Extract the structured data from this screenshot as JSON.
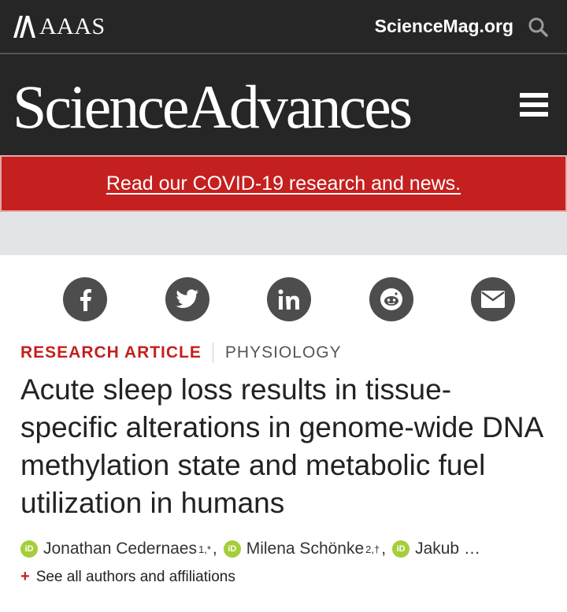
{
  "topbar": {
    "org_name": "AAAS",
    "site_link": "ScienceMag.org",
    "search_icon": "search-icon"
  },
  "masthead": {
    "brand": "ScienceAdvances",
    "menu_icon": "hamburger-menu-icon"
  },
  "banner": {
    "text": "Read our COVID-19 research and news.",
    "color": "#c4201f"
  },
  "share": {
    "items": [
      {
        "name": "facebook",
        "icon": "facebook-icon"
      },
      {
        "name": "twitter",
        "icon": "twitter-icon"
      },
      {
        "name": "linkedin",
        "icon": "linkedin-icon"
      },
      {
        "name": "reddit",
        "icon": "reddit-icon"
      },
      {
        "name": "email",
        "icon": "email-icon"
      }
    ]
  },
  "article": {
    "type": "RESEARCH ARTICLE",
    "subject": "PHYSIOLOGY",
    "title": "Acute sleep loss results in tissue-specific alterations in genome-wide DNA methylation state and metabolic fuel utilization in humans",
    "authors": [
      {
        "name": "Jonathan Cedernaes",
        "affil": "1,*"
      },
      {
        "name": "Milena Schönke",
        "affil": "2,†"
      },
      {
        "name": "Jakub …",
        "affil": ""
      }
    ],
    "orcid_label": "iD",
    "see_all": "See all authors and affiliations",
    "plus": "+"
  }
}
